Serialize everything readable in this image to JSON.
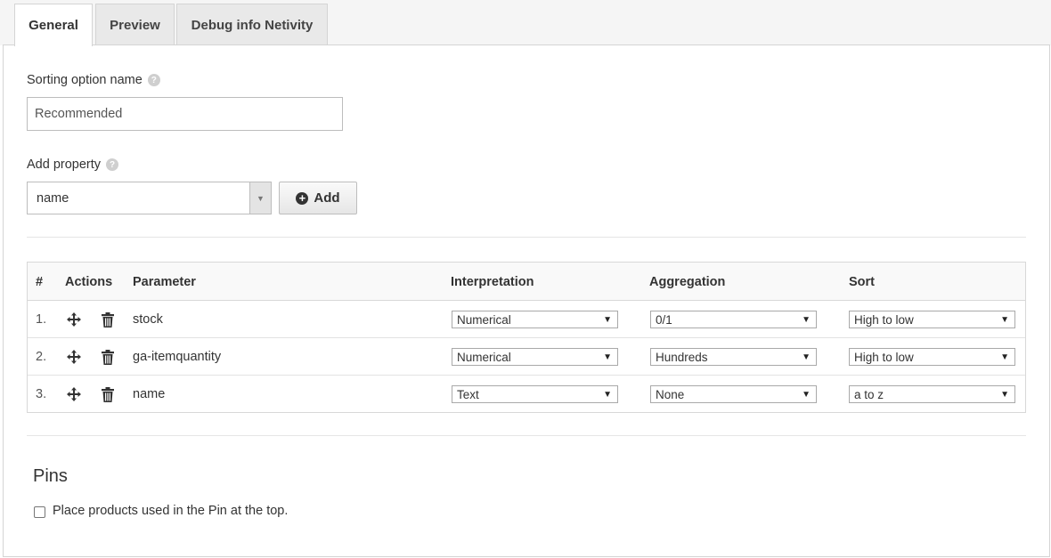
{
  "tabs": [
    {
      "label": "General",
      "active": true
    },
    {
      "label": "Preview",
      "active": false
    },
    {
      "label": "Debug info Netivity",
      "active": false
    }
  ],
  "form": {
    "sorting_name_label": "Sorting option name",
    "sorting_name_value": "Recommended",
    "add_property_label": "Add property",
    "add_property_value": "name",
    "add_button_label": "Add",
    "help_icon": "question-circle-icon"
  },
  "table": {
    "headers": {
      "num": "#",
      "actions": "Actions",
      "parameter": "Parameter",
      "interpretation": "Interpretation",
      "aggregation": "Aggregation",
      "sort": "Sort"
    },
    "rows": [
      {
        "num": "1.",
        "parameter": "stock",
        "interpretation": "Numerical",
        "aggregation": "0/1",
        "sort": "High to low"
      },
      {
        "num": "2.",
        "parameter": "ga-itemquantity",
        "interpretation": "Numerical",
        "aggregation": "Hundreds",
        "sort": "High to low"
      },
      {
        "num": "3.",
        "parameter": "name",
        "interpretation": "Text",
        "aggregation": "None",
        "sort": "a to z"
      }
    ]
  },
  "pins": {
    "title": "Pins",
    "checkbox_label": "Place products used in the Pin at the top.",
    "checked": false
  }
}
